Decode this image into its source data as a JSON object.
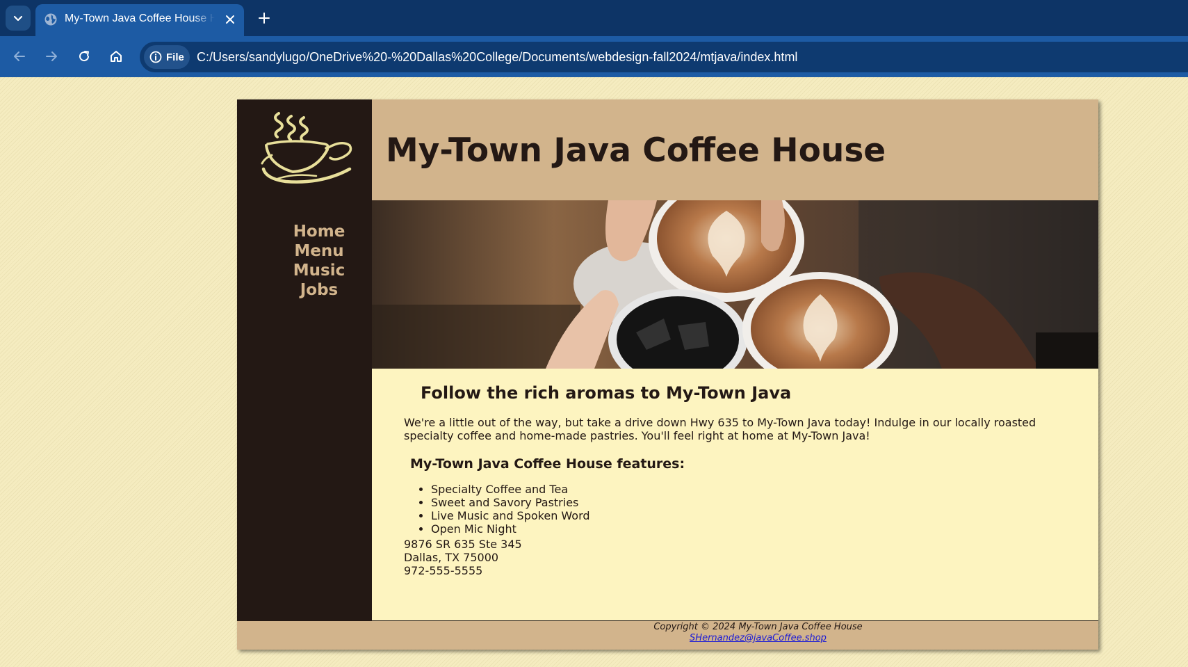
{
  "browser": {
    "tab": {
      "title": "My-Town Java Coffee House Home Page",
      "icon": "globe-icon"
    },
    "site_info_label": "File",
    "url": "C:/Users/sandylugo/OneDrive%20-%20Dallas%20College/Documents/webdesign-fall2024/mtjava/index.html",
    "colors": {
      "tabstrip": "#0d3466",
      "toolbar": "#1d5ba4"
    }
  },
  "page": {
    "title": "My-Town Java Coffee House",
    "nav": [
      "Home",
      "Menu",
      "Music",
      "Jobs"
    ],
    "heading": "Follow the rich aromas to My-Town Java",
    "intro": "We're a little out of the way, but take a drive down Hwy 635 to My-Town Java today! Indulge in our locally roasted specialty coffee and home-made pastries. You'll feel right at home at My-Town Java!",
    "features_heading": "My-Town Java Coffee House features:",
    "features": [
      "Specialty Coffee and Tea",
      "Sweet and Savory Pastries",
      "Live Music and Spoken Word",
      "Open Mic Night"
    ],
    "address": [
      "9876 SR 635 Ste 345",
      "Dallas, TX 75000",
      "972-555-5555"
    ],
    "footer": {
      "copyright": "Copyright © 2024 My-Town Java Coffee House",
      "email": "SHernandez@javaCoffee.shop"
    },
    "colors": {
      "sidebar": "#231814",
      "header": "#d2b48c",
      "content_bg": "#fdf4c0",
      "nav_text": "#d2b48c"
    }
  }
}
